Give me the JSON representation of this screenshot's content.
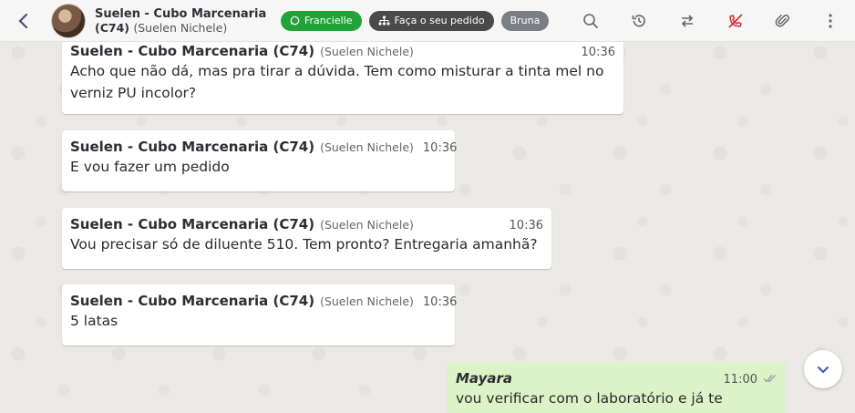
{
  "header": {
    "back_icon": "chevron-left-icon",
    "contact_name": "Suelen - Cubo Marcenaria",
    "contact_code": "(C74)",
    "contact_alt": "(Suelen Nichele)",
    "tags": [
      {
        "label": "Francielle",
        "icon": "whatsapp-icon",
        "color": "#22a33a"
      },
      {
        "label": "Faça o seu pedido",
        "icon": "sitemap-icon",
        "color": "#4a4a4a"
      },
      {
        "label": "Bruna",
        "color": "#7a7f86"
      }
    ],
    "actions": [
      "search-icon",
      "history-icon",
      "transfer-icon",
      "hangup-icon",
      "paperclip-icon",
      "more-vertical-icon"
    ]
  },
  "messages": [
    {
      "sender": "Suelen - Cubo Marcenaria (C74)",
      "sender_alt": "(Suelen Nichele)",
      "time": "10:36",
      "text": "Acho que não dá, mas pra tirar a dúvida. Tem como misturar a tinta mel no verniz PU incolor?"
    },
    {
      "sender": "Suelen - Cubo Marcenaria (C74)",
      "sender_alt": "(Suelen Nichele)",
      "time": "10:36",
      "text": "E vou fazer um pedido"
    },
    {
      "sender": "Suelen - Cubo Marcenaria (C74)",
      "sender_alt": "(Suelen Nichele)",
      "time": "10:36",
      "text": "Vou precisar só de diluente 510. Tem pronto? Entregaria amanhã?"
    },
    {
      "sender": "Suelen - Cubo Marcenaria (C74)",
      "sender_alt": "(Suelen Nichele)",
      "time": "10:36",
      "text": "5 latas"
    },
    {
      "sender": "Mayara",
      "time": "11:00",
      "status_icon": "double-check-icon",
      "text": "vou verificar com o laboratório e já te retorno"
    }
  ],
  "scroll_down_icon": "chevron-down-icon"
}
